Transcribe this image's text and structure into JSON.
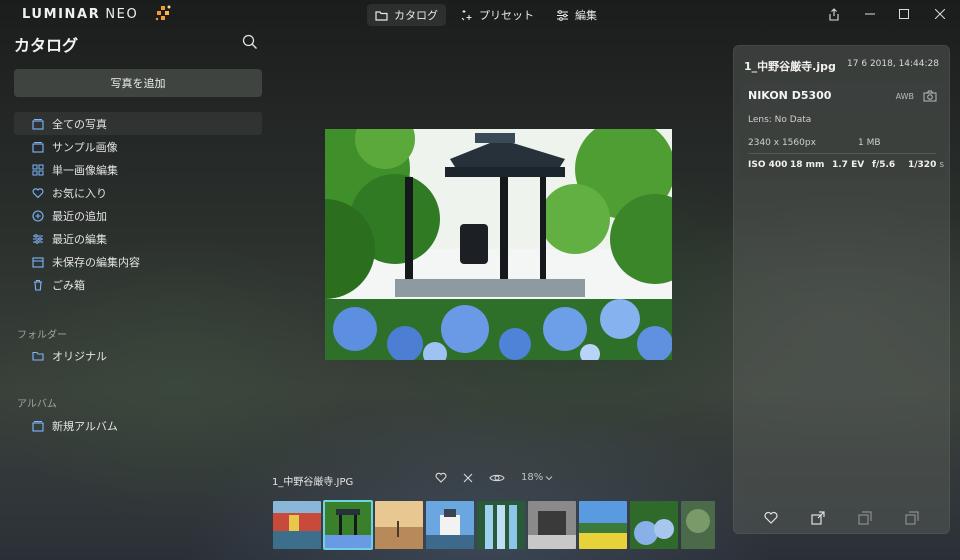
{
  "app": {
    "logo_text": "LUMINAR",
    "logo_suffix": "NEO"
  },
  "top_tabs": [
    {
      "label": "カタログ",
      "icon": "folder-icon",
      "active": true
    },
    {
      "label": "プリセット",
      "icon": "sparkle-icon",
      "active": false
    },
    {
      "label": "編集",
      "icon": "sliders-icon",
      "active": false
    }
  ],
  "window_controls": [
    "share-icon",
    "minimize-icon",
    "maximize-icon",
    "close-icon"
  ],
  "sidebar": {
    "title": "カタログ",
    "add_button": "写真を追加",
    "items": [
      {
        "label": "全ての写真",
        "icon": "all-photos-icon",
        "active": true
      },
      {
        "label": "サンプル画像",
        "icon": "sample-images-icon",
        "active": false
      },
      {
        "label": "単一画像編集",
        "icon": "grid-icon",
        "active": false
      },
      {
        "label": "お気に入り",
        "icon": "heart-icon",
        "active": false
      },
      {
        "label": "最近の追加",
        "icon": "plus-circle-icon",
        "active": false
      },
      {
        "label": "最近の編集",
        "icon": "sliders-icon",
        "active": false
      },
      {
        "label": "未保存の編集内容",
        "icon": "unsaved-icon",
        "active": false
      },
      {
        "label": "ごみ箱",
        "icon": "trash-icon",
        "active": false
      }
    ],
    "folders_label": "フォルダー",
    "folders": [
      {
        "label": "オリジナル",
        "icon": "folder-icon"
      }
    ],
    "albums_label": "アルバム",
    "albums": [
      {
        "label": "新規アルバム",
        "icon": "album-icon"
      }
    ]
  },
  "viewer": {
    "caption": "1_中野谷厳寺.JPG",
    "zoom": "18%"
  },
  "info": {
    "filename": "1_中野谷厳寺.jpg",
    "date": "17 6 2018, 14:44:28",
    "camera": "NIKON D5300",
    "awb": "AWB",
    "lens": "Lens: No Data",
    "dimensions": "2340 x 1560px",
    "file_size": "1 MB",
    "iso": "ISO 400",
    "focal": "18 mm",
    "ev": "1.7 EV",
    "aperture": "f/5.6",
    "shutter": "1/320",
    "shutter_unit": "s"
  },
  "colors": {
    "selection_outline": "#6dd3e0",
    "accent_blue": "#7fb6ff",
    "logo_mark": "#f59a2f"
  }
}
